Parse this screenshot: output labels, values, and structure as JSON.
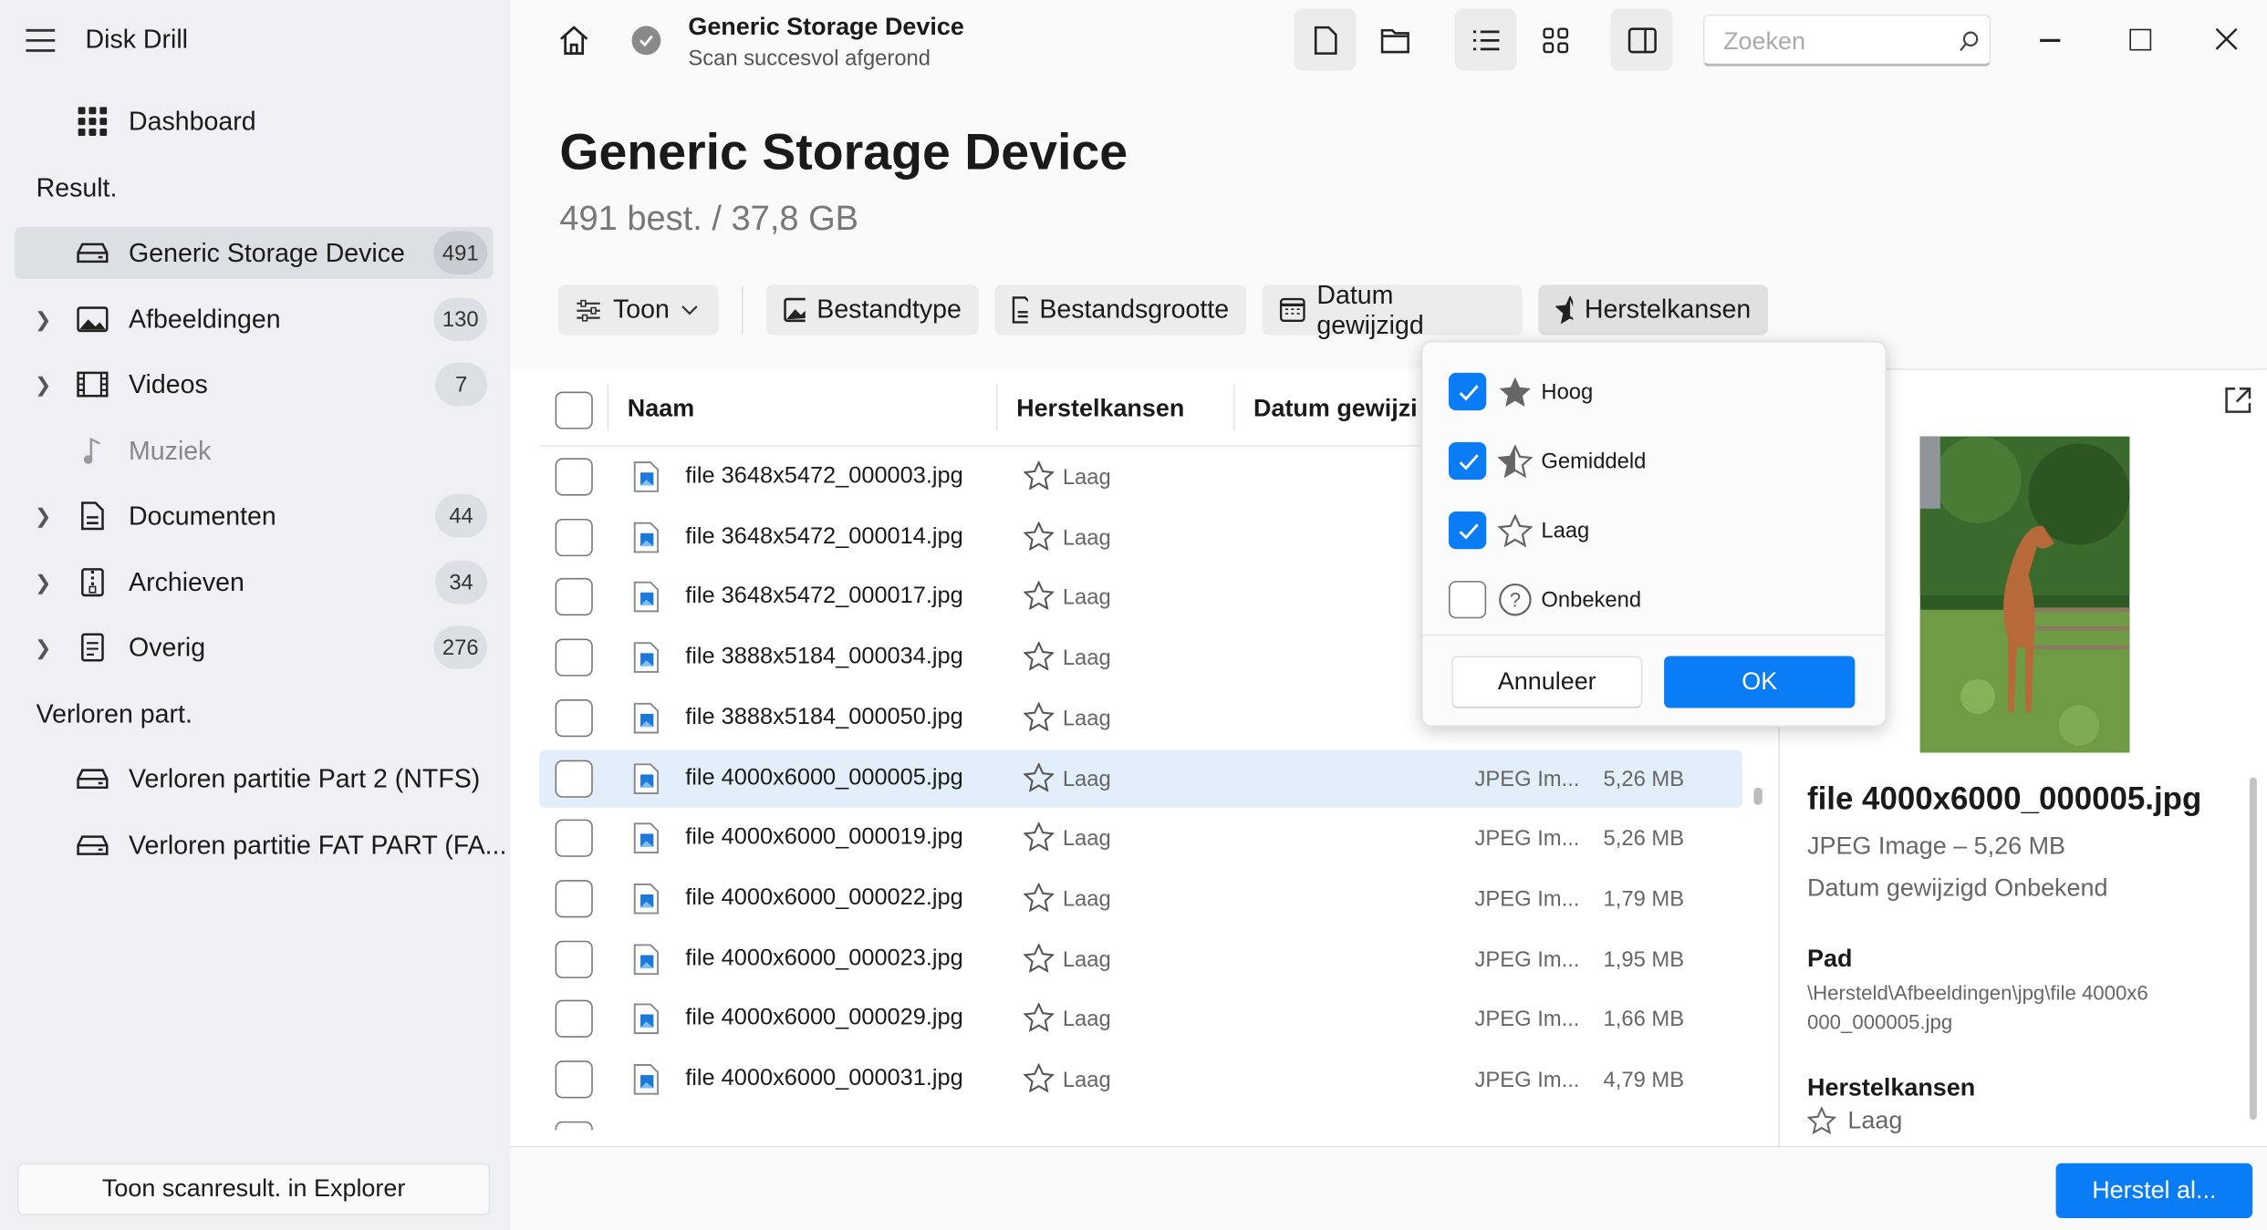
{
  "app": {
    "title": "Disk Drill"
  },
  "sidebar": {
    "dashboard": "Dashboard",
    "results_heading": "Result.",
    "items": [
      {
        "label": "Generic Storage Device",
        "count": "491",
        "icon": "drive-icon",
        "selected": true
      },
      {
        "label": "Afbeeldingen",
        "count": "130",
        "icon": "image-icon"
      },
      {
        "label": "Videos",
        "count": "7",
        "icon": "film-icon"
      },
      {
        "label": "Muziek",
        "count": "",
        "icon": "music-icon",
        "disabled": true
      },
      {
        "label": "Documenten",
        "count": "44",
        "icon": "document-icon"
      },
      {
        "label": "Archieven",
        "count": "34",
        "icon": "archive-icon"
      },
      {
        "label": "Overig",
        "count": "276",
        "icon": "other-file-icon"
      }
    ],
    "lost_heading": "Verloren part.",
    "lost": [
      {
        "label": "Verloren partitie Part 2 (NTFS)"
      },
      {
        "label": "Verloren partitie FAT PART (FA..."
      }
    ],
    "explorer_button": "Toon scanresult. in Explorer"
  },
  "topbar": {
    "title": "Generic Storage Device",
    "subtitle": "Scan succesvol afgerond",
    "search_placeholder": "Zoeken"
  },
  "main": {
    "heading": "Generic Storage Device",
    "summary": "491 best. / 37,8 GB"
  },
  "filters": {
    "show": "Toon",
    "filetype": "Bestandtype",
    "filesize": "Bestandsgrootte",
    "date": "Datum gewijzigd",
    "chances": "Herstelkansen"
  },
  "table": {
    "headers": {
      "name": "Naam",
      "chances": "Herstelkansen",
      "date": "Datum gewijzi"
    },
    "rows": [
      {
        "name": "file 3648x5472_000003.jpg",
        "chance": "Laag"
      },
      {
        "name": "file 3648x5472_000014.jpg",
        "chance": "Laag"
      },
      {
        "name": "file 3648x5472_000017.jpg",
        "chance": "Laag"
      },
      {
        "name": "file 3888x5184_000034.jpg",
        "chance": "Laag"
      },
      {
        "name": "file 3888x5184_000050.jpg",
        "chance": "Laag"
      },
      {
        "name": "file 4000x6000_000005.jpg",
        "chance": "Laag",
        "type": "JPEG Im...",
        "size": "5,26 MB",
        "selected": true
      },
      {
        "name": "file 4000x6000_000019.jpg",
        "chance": "Laag",
        "type": "JPEG Im...",
        "size": "5,26 MB"
      },
      {
        "name": "file 4000x6000_000022.jpg",
        "chance": "Laag",
        "type": "JPEG Im...",
        "size": "1,79 MB"
      },
      {
        "name": "file 4000x6000_000023.jpg",
        "chance": "Laag",
        "type": "JPEG Im...",
        "size": "1,95 MB"
      },
      {
        "name": "file 4000x6000_000029.jpg",
        "chance": "Laag",
        "type": "JPEG Im...",
        "size": "1,66 MB"
      },
      {
        "name": "file 4000x6000_000031.jpg",
        "chance": "Laag",
        "type": "JPEG Im...",
        "size": "4,79 MB"
      }
    ]
  },
  "popup": {
    "options": [
      {
        "label": "Hoog",
        "checked": true,
        "icon": "star-filled-icon"
      },
      {
        "label": "Gemiddeld",
        "checked": true,
        "icon": "star-half-icon"
      },
      {
        "label": "Laag",
        "checked": true,
        "icon": "star-outline-icon"
      },
      {
        "label": "Onbekend",
        "checked": false,
        "icon": "question-icon"
      }
    ],
    "cancel": "Annuleer",
    "ok": "OK"
  },
  "preview": {
    "filename": "file 4000x6000_000005.jpg",
    "meta": "JPEG Image – 5,26 MB",
    "date": "Datum gewijzigd Onbekend",
    "path_label": "Pad",
    "path": "\\Hersteld\\Afbeeldingen\\jpg\\file 4000x6000_000005.jpg",
    "chances_label": "Herstelkansen",
    "chance": "Laag"
  },
  "recover_button": "Herstel al...",
  "colors": {
    "accent": "#0a7cf5",
    "selected_row": "#e2effa",
    "sidebar": "#eef0f3"
  }
}
